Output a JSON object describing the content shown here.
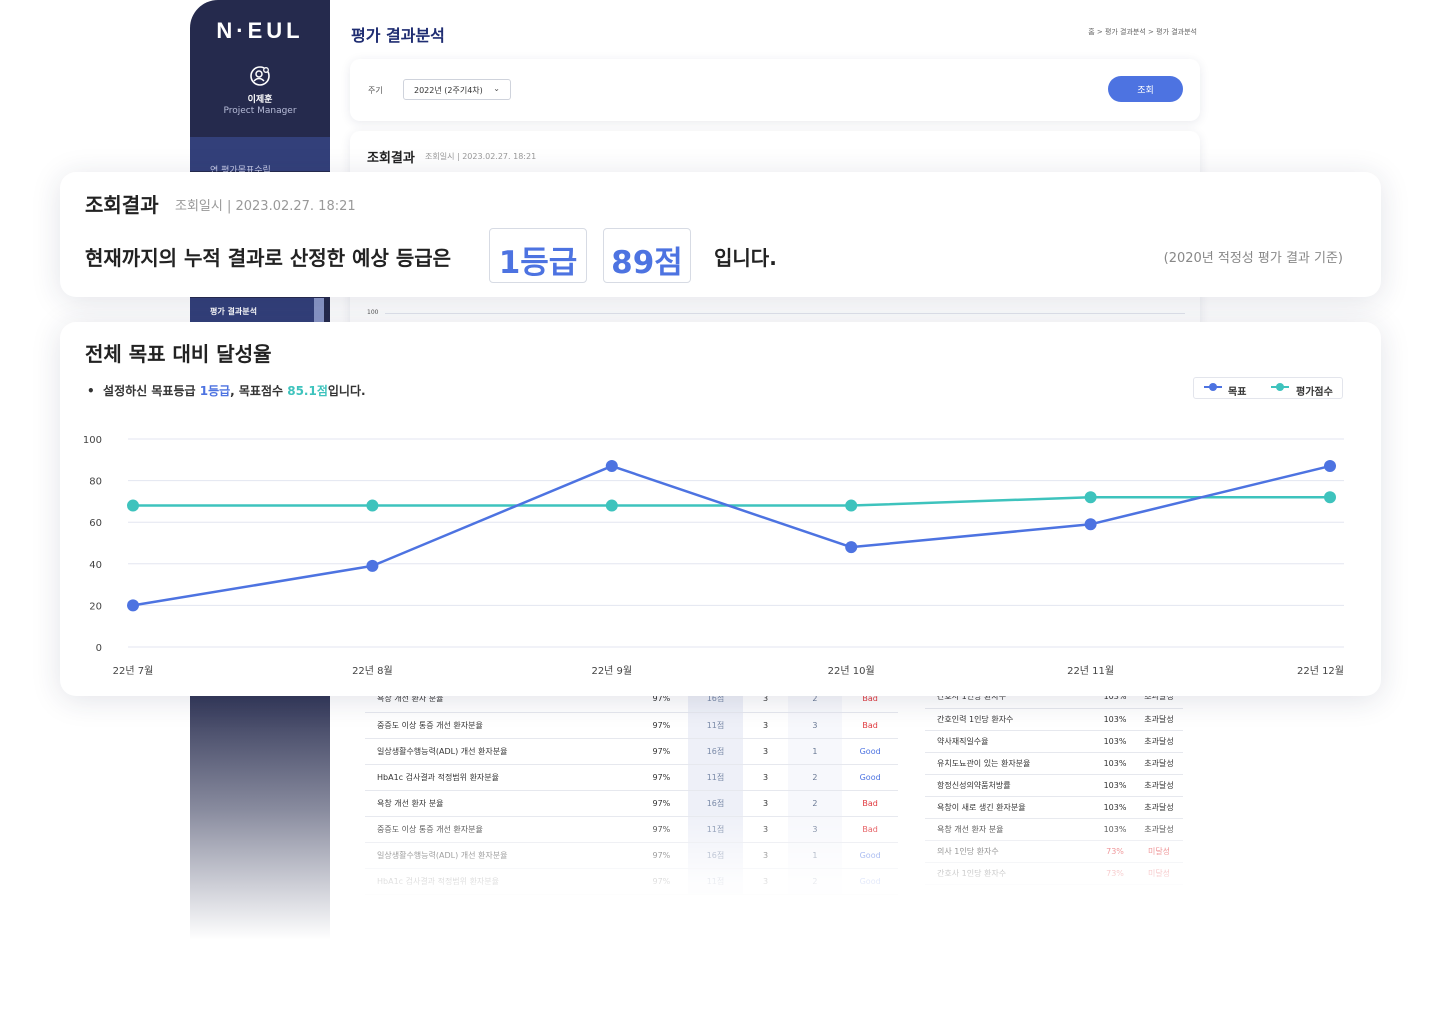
{
  "brand": {
    "logo": "N·EUL"
  },
  "user": {
    "name": "이제훈",
    "role": "Project Manager"
  },
  "sidebar": {
    "menu_top": "연 평가목표수립",
    "menu_active": "평가 결과분석"
  },
  "page": {
    "title": "평가 결과분석",
    "breadcrumb": "홈 > 평가 결과분석 > 평가 결과분석"
  },
  "filter": {
    "label": "주기",
    "select_value": "2022년 (2주기4차)",
    "search_button": "조회"
  },
  "bg_result": {
    "title": "조회결과",
    "datetime": "조회일시 | 2023.02.27. 18:21",
    "axis_100": "100"
  },
  "result": {
    "title": "조회결과",
    "datetime": "조회일시 | 2023.02.27. 18:21",
    "sentence": "현재까지의 누적 결과로 산정한 예상 등급은",
    "grade": "1등급",
    "score": "89점",
    "suffix": "입니다.",
    "basis": "(2020년 적정성 평가 결과 기준)"
  },
  "achievement": {
    "title": "전체 목표 대비 달성율",
    "desc_prefix": "설정하신 목표등급 ",
    "desc_grade": "1등급",
    "desc_mid": ", 목표점수 ",
    "desc_score": "85.1점",
    "desc_suffix": "입니다."
  },
  "chart_data": {
    "type": "line",
    "categories": [
      "22년 7월",
      "22년 8월",
      "22년 9월",
      "22년 10월",
      "22년 11월",
      "22년 12월"
    ],
    "series": [
      {
        "name": "목표",
        "color": "#4d73e1",
        "values": [
          20,
          39,
          87,
          48,
          59,
          87
        ]
      },
      {
        "name": "평가점수",
        "color": "#3ec3bd",
        "values": [
          68,
          68,
          68,
          68,
          72,
          72
        ]
      }
    ],
    "ylim": [
      0,
      100
    ],
    "yticks": [
      "0",
      "20",
      "40",
      "60",
      "80",
      "100"
    ],
    "grid": true,
    "legend": "top-right"
  },
  "left_table": {
    "rows": [
      {
        "name": "욕창 개선 환자 분율",
        "pct": "97%",
        "pt": "16점",
        "n1": "3",
        "n2": "2",
        "status": "Bad",
        "kind": "bad"
      },
      {
        "name": "중증도 이상 통증 개선 환자분율",
        "pct": "97%",
        "pt": "11점",
        "n1": "3",
        "n2": "3",
        "status": "Bad",
        "kind": "bad"
      },
      {
        "name": "일상생활수행능력(ADL) 개선 환자분율",
        "pct": "97%",
        "pt": "16점",
        "n1": "3",
        "n2": "1",
        "status": "Good",
        "kind": "good"
      },
      {
        "name": "HbA1c 검사결과 적정범위 환자분율",
        "pct": "97%",
        "pt": "11점",
        "n1": "3",
        "n2": "2",
        "status": "Good",
        "kind": "good"
      },
      {
        "name": "욕창 개선 환자 분율",
        "pct": "97%",
        "pt": "16점",
        "n1": "3",
        "n2": "2",
        "status": "Bad",
        "kind": "bad"
      },
      {
        "name": "중증도 이상 통증 개선 환자분율",
        "pct": "97%",
        "pt": "11점",
        "n1": "3",
        "n2": "3",
        "status": "Bad",
        "kind": "bad"
      },
      {
        "name": "일상생활수행능력(ADL) 개선 환자분율",
        "pct": "97%",
        "pt": "16점",
        "n1": "3",
        "n2": "1",
        "status": "Good",
        "kind": "good"
      },
      {
        "name": "HbA1c 검사결과 적정범위 환자분율",
        "pct": "97%",
        "pt": "11점",
        "n1": "3",
        "n2": "2",
        "status": "Good",
        "kind": "good"
      }
    ]
  },
  "right_table": {
    "rows": [
      {
        "name": "간호사 1인당 환자수",
        "pct": "103%",
        "status": "초과달성",
        "kind": ""
      },
      {
        "name": "간호인력 1인당 환자수",
        "pct": "103%",
        "status": "초과달성",
        "kind": ""
      },
      {
        "name": "약사재직일수율",
        "pct": "103%",
        "status": "초과달성",
        "kind": ""
      },
      {
        "name": "유치도뇨관이 있는 환자분율",
        "pct": "103%",
        "status": "초과달성",
        "kind": ""
      },
      {
        "name": "항정신성의약품처방률",
        "pct": "103%",
        "status": "초과달성",
        "kind": ""
      },
      {
        "name": "욕창이 새로 생긴 환자분율",
        "pct": "103%",
        "status": "초과달성",
        "kind": ""
      },
      {
        "name": "욕창 개선 환자 분율",
        "pct": "103%",
        "status": "초과달성",
        "kind": ""
      },
      {
        "name": "의사 1인당 환자수",
        "pct": "73%",
        "status": "미달성",
        "kind": "red"
      },
      {
        "name": "간호사 1인당 환자수",
        "pct": "73%",
        "status": "미달성",
        "kind": "red"
      }
    ]
  }
}
